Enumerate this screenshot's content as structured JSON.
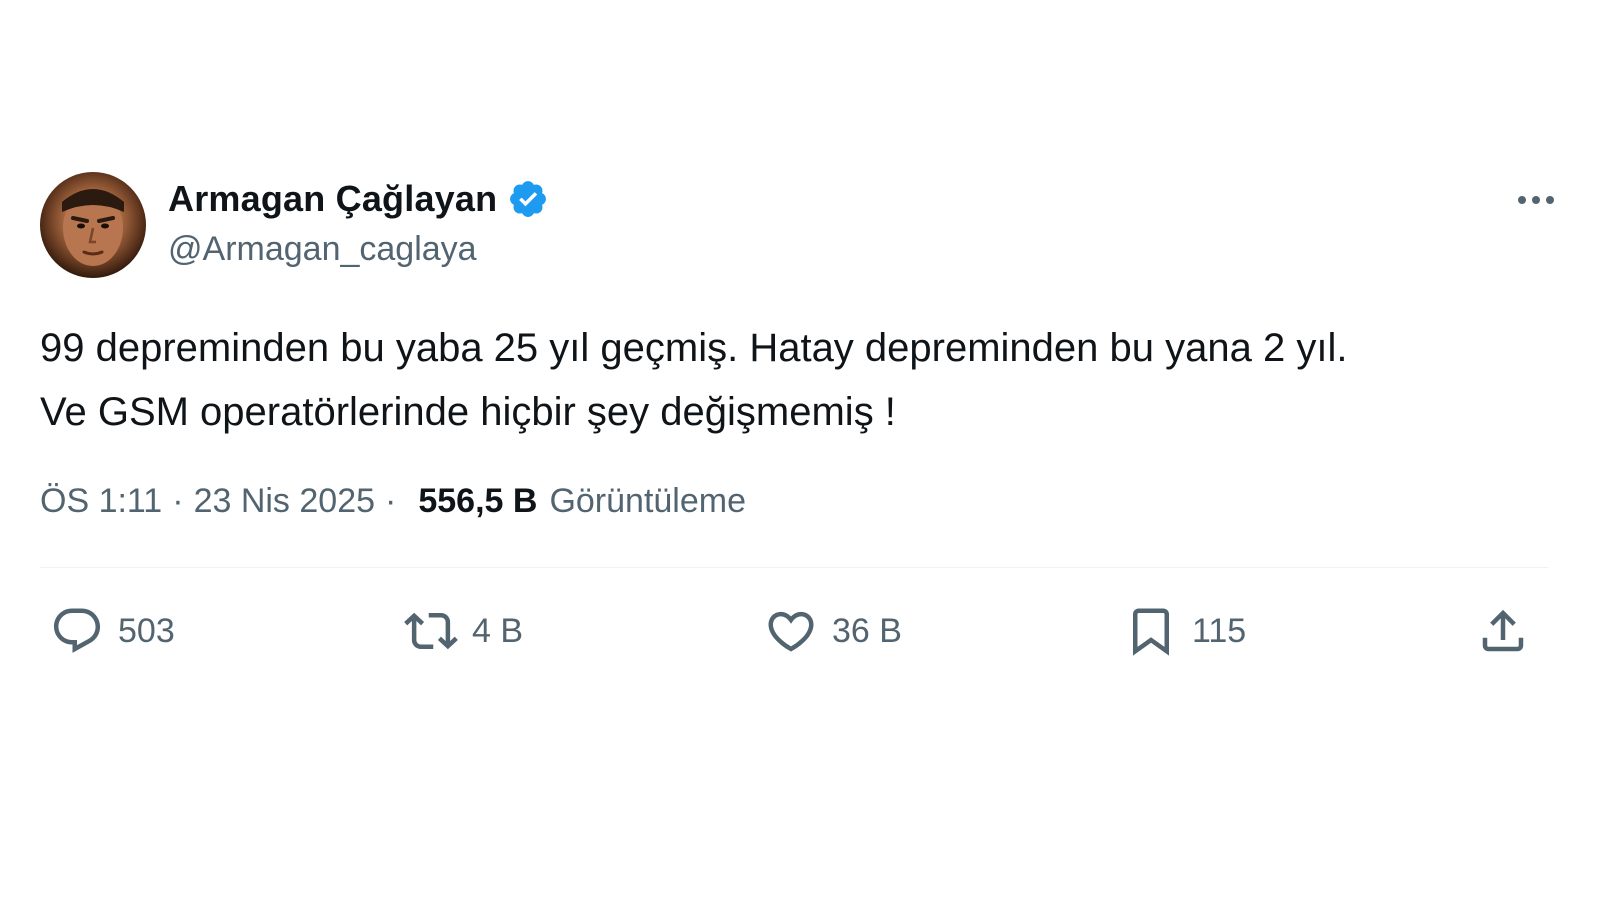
{
  "tweet": {
    "author": {
      "display_name": "Armagan Çağlayan",
      "handle": "@Armagan_caglaya",
      "verified": true,
      "avatar_icon": "profile-photo"
    },
    "text": "99 depreminden bu yaba 25 yıl geçmiş. Hatay depreminden bu yana 2 yıl.\nVe GSM operatörlerinde hiçbir şey değişmemiş !",
    "time": "ÖS 1:11",
    "date": "23 Nis 2025",
    "separator": "·",
    "views_count": "556,5 B",
    "views_label": "Görüntüleme"
  },
  "actions": {
    "reply": {
      "icon": "reply-icon",
      "count": "503"
    },
    "retweet": {
      "icon": "retweet-icon",
      "count": "4 B"
    },
    "like": {
      "icon": "heart-icon",
      "count": "36 B"
    },
    "bookmark": {
      "icon": "bookmark-icon",
      "count": "115"
    },
    "share": {
      "icon": "share-icon"
    }
  },
  "colors": {
    "verified_badge": "#1d9bf0",
    "text_primary": "#0f1419",
    "text_secondary": "#536471",
    "divider": "#eff3f4"
  }
}
